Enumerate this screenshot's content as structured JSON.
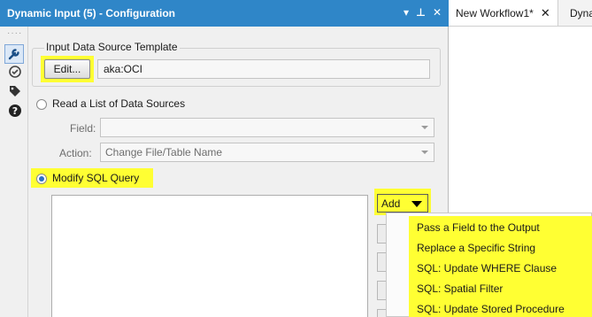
{
  "panel": {
    "title": "Dynamic Input (5) - Configuration",
    "controls": {
      "dropdown": "▾",
      "pin": "⊥",
      "close": "✕"
    }
  },
  "sidebar": {
    "dots": "····",
    "icons": [
      "wrench-icon",
      "tool-icon",
      "tag-icon",
      "help-icon"
    ]
  },
  "template": {
    "group_title": "Input Data Source Template",
    "edit_label": "Edit...",
    "value": "aka:OCI"
  },
  "list_option": {
    "label": "Read a List of Data Sources",
    "field_label": "Field:",
    "field_value": "",
    "action_label": "Action:",
    "action_value": "Change File/Table Name"
  },
  "modify_option": {
    "label": "Modify SQL Query",
    "selected": true
  },
  "add_button": {
    "label": "Add"
  },
  "menu": {
    "items": [
      "Pass a Field to the Output",
      "Replace a Specific String",
      "SQL: Update WHERE Clause",
      "SQL: Spatial Filter",
      "SQL: Update Stored Procedure"
    ]
  },
  "tabs": {
    "active": "New Workflow1*",
    "close": "✕",
    "next": "Dynam"
  },
  "colors": {
    "titlebar": "#2f86c8",
    "highlight": "#ffff33"
  }
}
